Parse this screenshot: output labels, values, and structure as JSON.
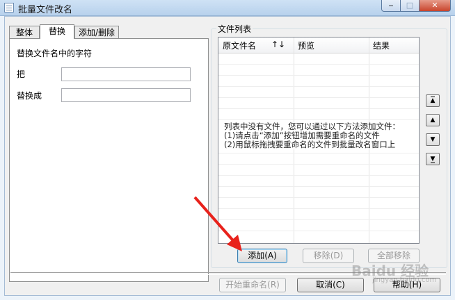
{
  "window": {
    "title": "批量文件改名"
  },
  "tabs": [
    {
      "label": "整体"
    },
    {
      "label": "替换"
    },
    {
      "label": "添加/删除"
    }
  ],
  "replace_panel": {
    "heading": "替换文件名中的字符",
    "find_label": "把",
    "find_value": "",
    "replace_label": "替换成",
    "replace_value": ""
  },
  "file_list": {
    "group_title": "文件列表",
    "columns": [
      "原文件名",
      "预览",
      "结果"
    ],
    "sort_glyph": "↑↓",
    "empty_message": "列表中没有文件，您可以通过以下方法添加文件：\n  (1)请点击“添加”按钮增加需要重命名的文件\n  (2)用鼠标拖拽要重命名的文件到批量改名窗口上"
  },
  "nav_buttons": {
    "top": "▲",
    "up": "▲",
    "down": "▼",
    "bottom": "▼"
  },
  "buttons": {
    "add": "添加(A)",
    "remove": "移除(D)",
    "remove_all": "全部移除",
    "start": "开始重命名(R)",
    "cancel": "取消(C)",
    "help": "帮助(H)"
  },
  "watermark": {
    "text": "Baidu 经验",
    "sub": "jingyan.baidu.com"
  },
  "colors": {
    "annotation_arrow": "#e8221c"
  }
}
